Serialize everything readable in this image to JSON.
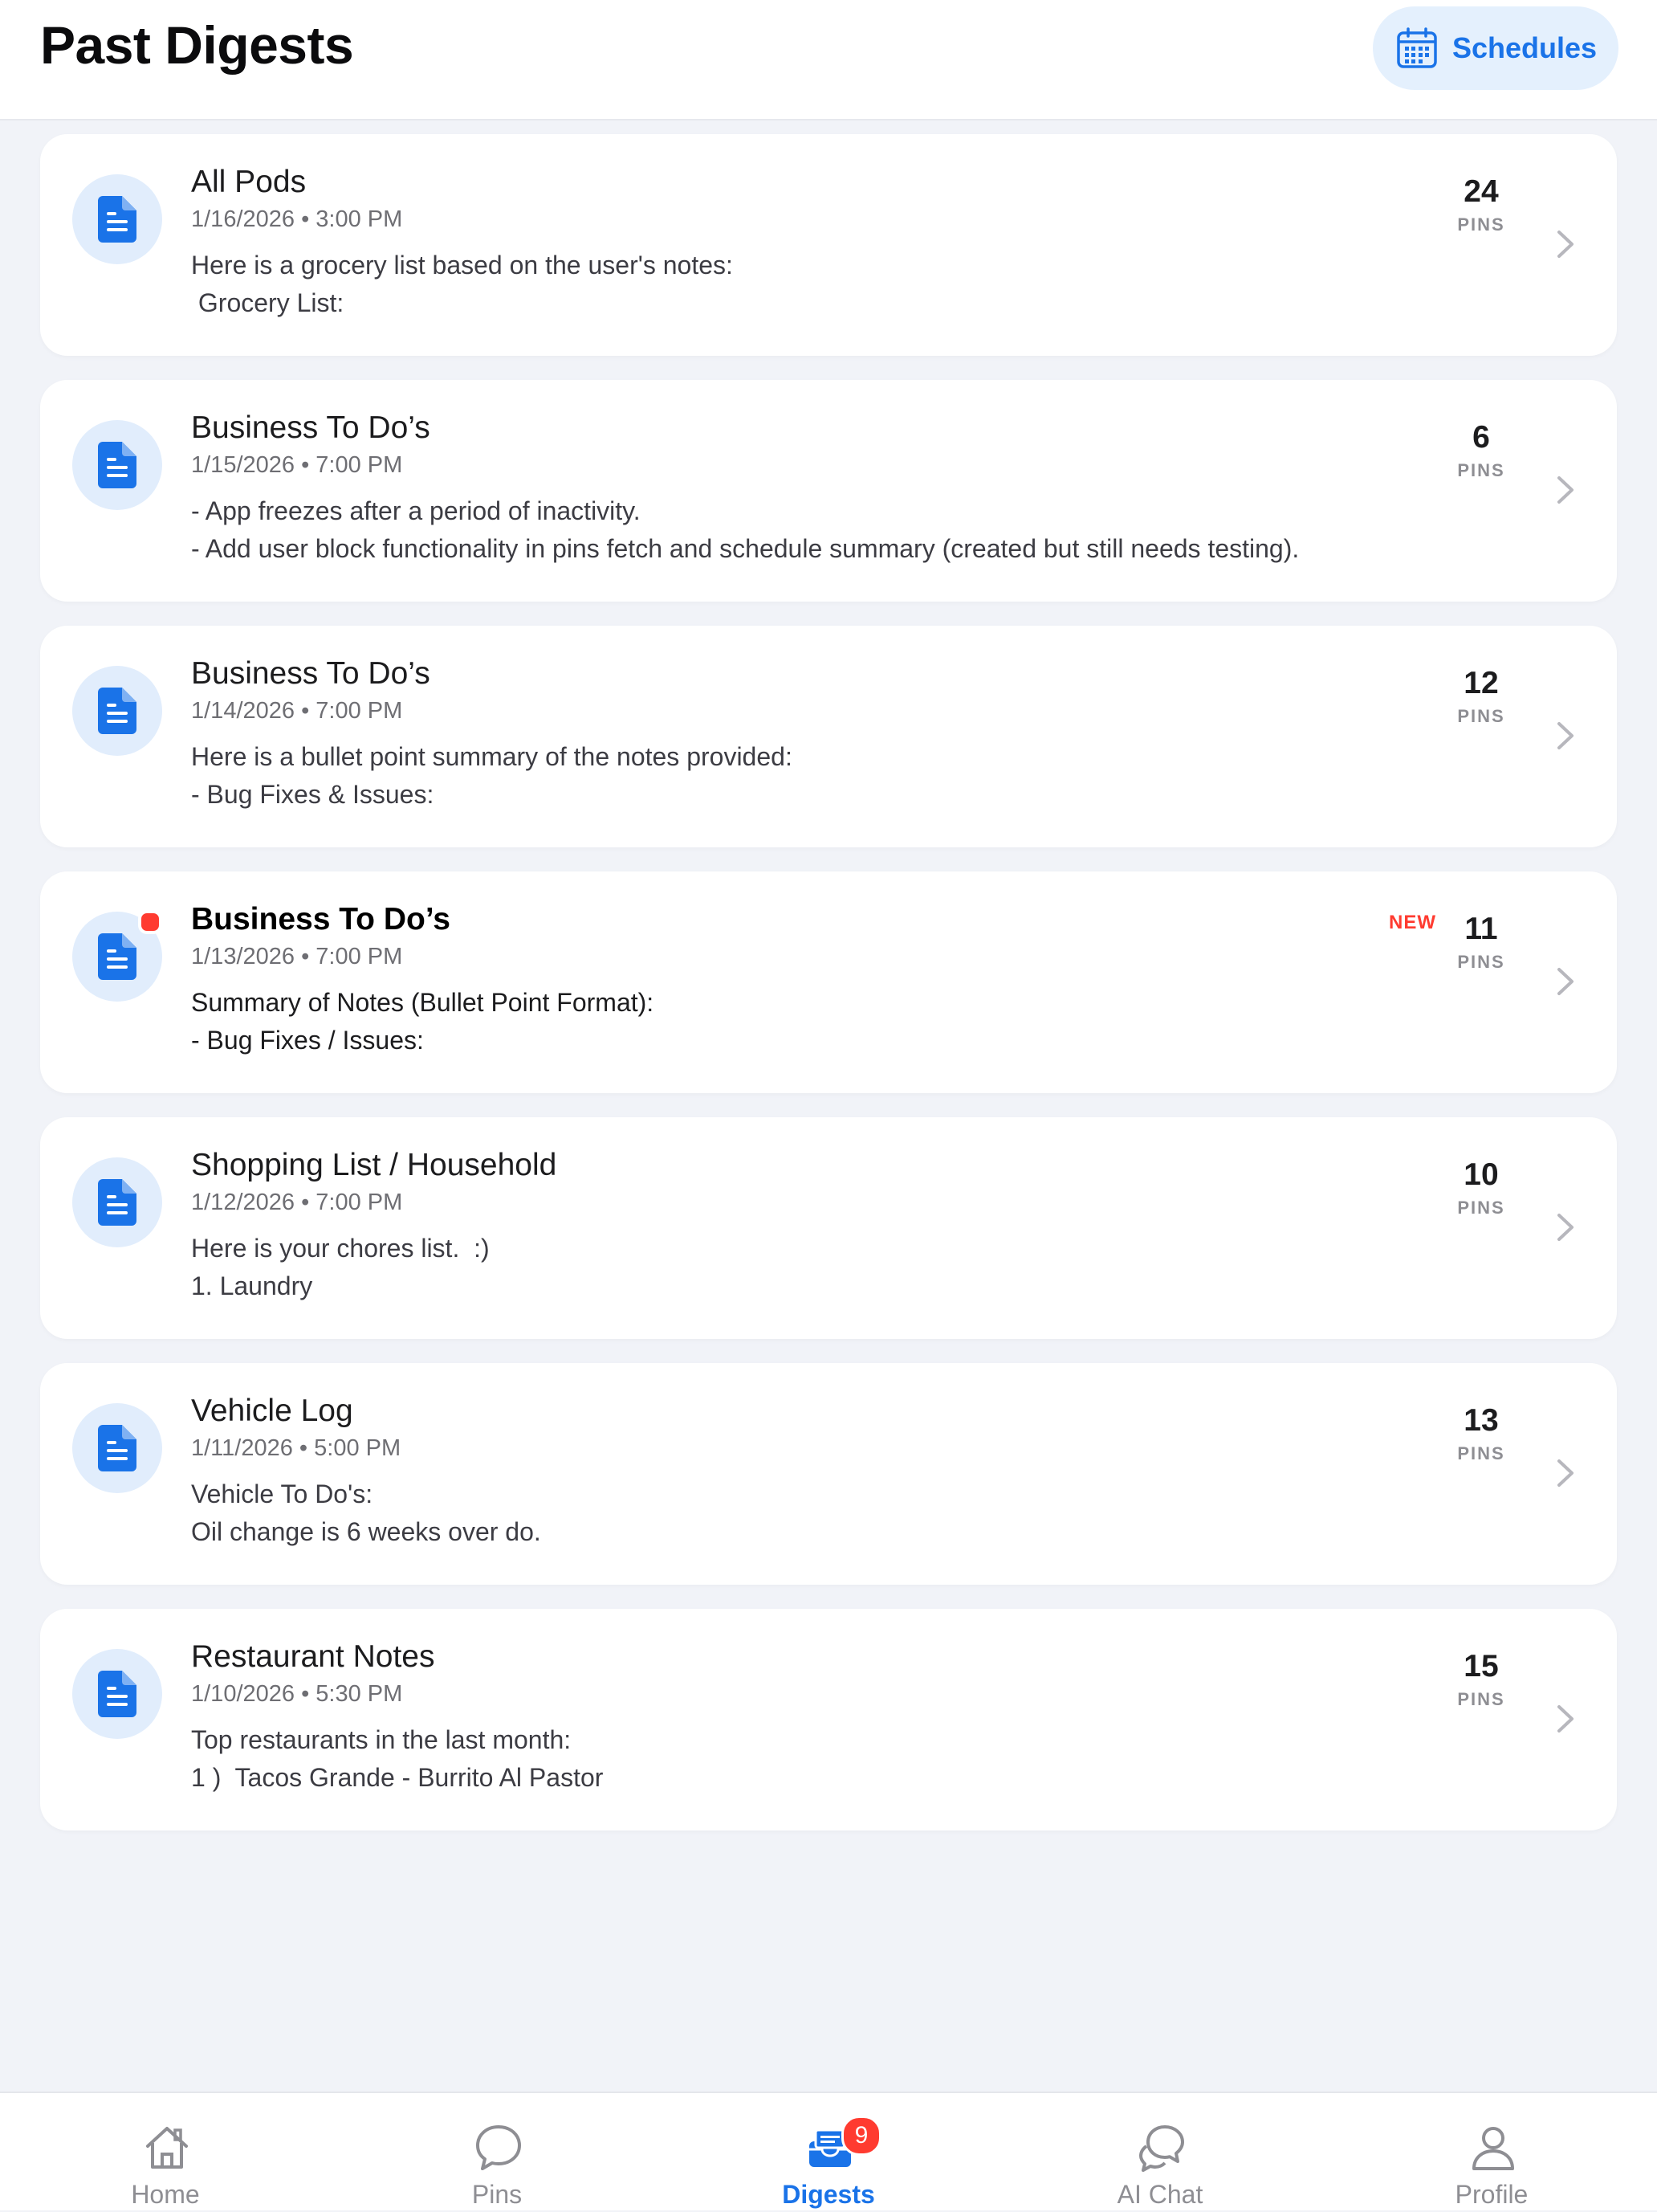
{
  "header": {
    "title": "Past Digests",
    "schedules_label": "Schedules"
  },
  "pins_unit": "PINS",
  "new_label": "NEW",
  "digests": [
    {
      "title": "All Pods",
      "date": "1/16/2026 • 3:00 PM",
      "line1": "Here is a grocery list based on the user's notes:",
      "line2": " Grocery List:",
      "pins": "24",
      "is_new": false
    },
    {
      "title": "Business To Do’s",
      "date": "1/15/2026 • 7:00 PM",
      "line1": "- App freezes after a period of inactivity.",
      "line2": "- Add user block functionality in pins fetch and schedule summary (created but still needs testing).",
      "pins": "6",
      "is_new": false
    },
    {
      "title": "Business To Do’s",
      "date": "1/14/2026 • 7:00 PM",
      "line1": "Here is a bullet point summary of the notes provided:",
      "line2": "- Bug Fixes & Issues:",
      "pins": "12",
      "is_new": false
    },
    {
      "title": "Business To Do’s",
      "date": "1/13/2026 • 7:00 PM",
      "line1": "Summary of Notes (Bullet Point Format):",
      "line2": "- Bug Fixes / Issues:",
      "pins": "11",
      "is_new": true
    },
    {
      "title": "Shopping List / Household",
      "date": "1/12/2026 • 7:00 PM",
      "line1": "Here is your chores list.  :)",
      "line2": "1. Laundry",
      "pins": "10",
      "is_new": false
    },
    {
      "title": "Vehicle Log",
      "date": "1/11/2026 • 5:00 PM",
      "line1": "Vehicle To Do's:",
      "line2": "Oil change is 6 weeks over do.",
      "pins": "13",
      "is_new": false
    },
    {
      "title": "Restaurant Notes",
      "date": "1/10/2026 • 5:30 PM",
      "line1": "Top restaurants in the last month:",
      "line2": "1 )  Tacos Grande - Burrito Al Pastor",
      "pins": "15",
      "is_new": false
    }
  ],
  "tabbar": {
    "tabs": [
      {
        "label": "Home",
        "icon": "house-icon",
        "active": false
      },
      {
        "label": "Pins",
        "icon": "chat-bubble-icon",
        "active": false
      },
      {
        "label": "Digests",
        "icon": "inbox-tray-icon",
        "active": true,
        "badge": "9"
      },
      {
        "label": "AI Chat",
        "icon": "chat-bubbles-icon",
        "active": false
      },
      {
        "label": "Profile",
        "icon": "person-icon",
        "active": false
      }
    ]
  },
  "colors": {
    "accent": "#1a73e8",
    "background": "#f1f3f8",
    "new": "#ff3b30",
    "icon_circle": "#e1edfc"
  }
}
